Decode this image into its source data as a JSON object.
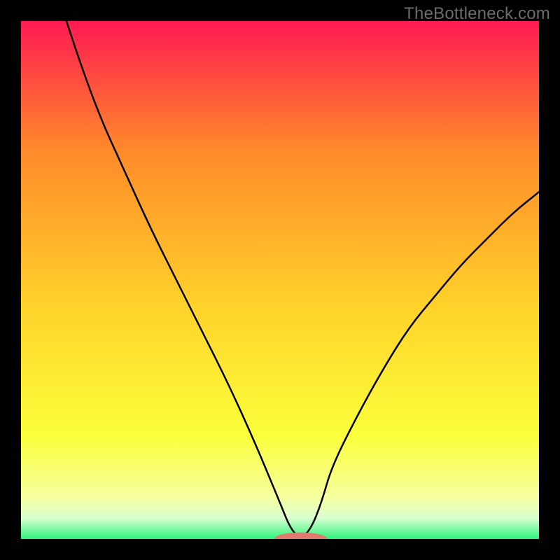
{
  "watermark": "TheBottleneck.com",
  "colors": {
    "background": "#000000",
    "gradient_top": "#ff1a52",
    "gradient_upper_mid": "#ff8a2a",
    "gradient_mid": "#ffd22a",
    "gradient_lower_mid": "#faff3a",
    "gradient_near_bottom": "#f6ffa0",
    "gradient_bottom_band": "#d8ffd0",
    "gradient_bottom": "#2cf27a",
    "curve": "#000000",
    "marker_fill": "#e07a6f",
    "marker_stroke": "#e07a6f"
  },
  "chart_data": {
    "type": "line",
    "title": "",
    "xlabel": "",
    "ylabel": "",
    "xlim": [
      0,
      100
    ],
    "ylim": [
      0,
      100
    ],
    "x": [
      0,
      5,
      10,
      15,
      20,
      25,
      30,
      35,
      40,
      45,
      50,
      52,
      54,
      56,
      58,
      60,
      65,
      70,
      75,
      80,
      85,
      90,
      95,
      100
    ],
    "series": [
      {
        "name": "bottleneck-curve",
        "values": [
          135,
          112,
          96,
          82,
          71,
          60,
          50,
          40,
          30,
          19,
          7,
          2,
          0,
          2,
          7,
          14,
          24,
          33,
          41,
          47,
          53,
          58,
          63,
          67
        ]
      }
    ],
    "marker": {
      "x": 54,
      "y": 0,
      "rw": 5,
      "rh": 1.2
    }
  }
}
